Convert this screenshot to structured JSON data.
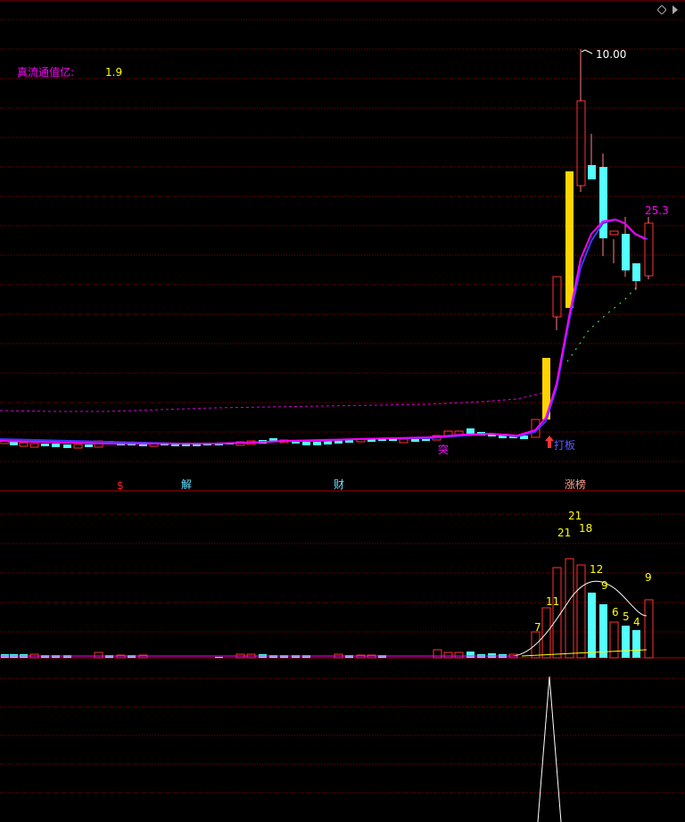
{
  "indicator": {
    "label": "真流通值亿:",
    "value": "1.9",
    "label_color": "#ff00ff",
    "value_color": "#ffff00"
  },
  "icons": {
    "top_right": "diamond-icon",
    "signal_arrow": "up-arrow-icon"
  },
  "main_chart": {
    "max_price_label": "10.00",
    "ma_end_label": "25.3",
    "signal_labels": {
      "tu": "突",
      "daban": "打板"
    }
  },
  "event_markers": [
    {
      "text": "$",
      "color": "#ff2020"
    },
    {
      "text": "解",
      "color": "#66e0ff"
    },
    {
      "text": "财",
      "color": "#66e0ff"
    },
    {
      "text": "涨榜",
      "color": "#ff9f8f"
    }
  ],
  "volume_labels": [
    "7",
    "11",
    "21",
    "21",
    "18",
    "12",
    "9",
    "6",
    "5",
    "4",
    "9"
  ],
  "colors": {
    "grid": "#8a0000",
    "up": "#ff3232",
    "down": "#54ffff",
    "limit_up": "#ffd400",
    "ma_short": "#ff00ff",
    "ma_long": "#3a3aff",
    "volume_ma": "#ffffff",
    "volume_label": "#ffff00",
    "spike": "#ffffff"
  },
  "chart_data": {
    "type": "candlestick",
    "series": [
      {
        "name": "price",
        "note": "daily candles, right-most bars show a sharp rally to limit-up"
      },
      {
        "name": "volume"
      }
    ]
  }
}
